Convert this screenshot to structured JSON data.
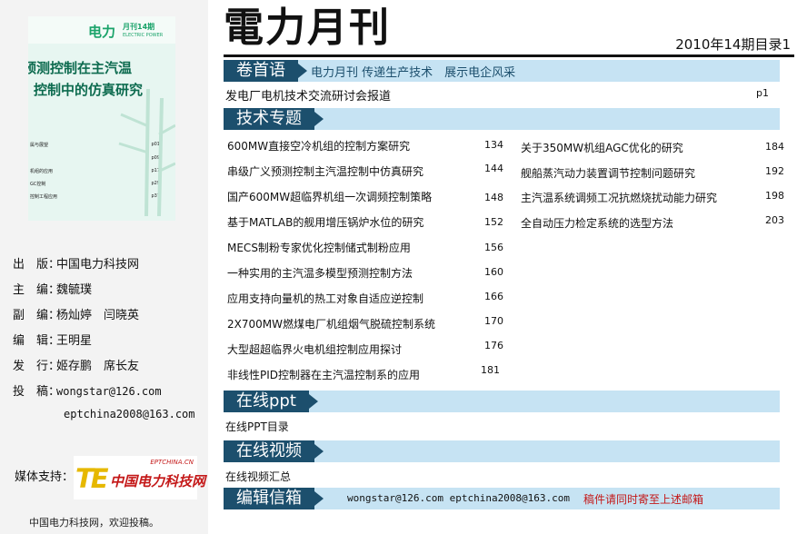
{
  "cover": {
    "brand": "电力",
    "issue": "月刊14期",
    "subtitle": "ELECTRIC POWER",
    "title_line1": "预测控制在主汽温",
    "title_line2": "控制中的仿真研究",
    "toc": [
      {
        "text": "属与展望",
        "page": "p01"
      },
      {
        "text": "",
        "page": "p09"
      },
      {
        "text": "机组的应用",
        "page": "p17"
      },
      {
        "text": "GC控制",
        "page": "p29"
      },
      {
        "text": "控制工程应用",
        "page": "p37"
      }
    ]
  },
  "sidebar_info": {
    "publisher_label": "出　版：",
    "publisher": "中国电力科技网",
    "chief_label": "主　编：",
    "chief": "魏毓璞",
    "deputy_label": "副　编：",
    "deputy": "杨灿婷　闫晓英",
    "editor_label": "编　辑：",
    "editor": "王明星",
    "distributor_label": "发　行：",
    "distributor": "姬存鹏　席长友",
    "submit_label": "投　稿：",
    "email1": "wongstar@126.com",
    "email2": "eptchina2008@163.com",
    "media_label": "媒体支持：",
    "media_logo_te": "TE",
    "media_logo_name": "中国电力科技网",
    "media_logo_tag": "EPTCHINA.CN",
    "footer": "中国电力科技网，欢迎投稿。"
  },
  "header": {
    "masthead": "電力月刊",
    "issue": "2010年14期目录1"
  },
  "sections": {
    "preface": {
      "title": "卷首语",
      "slogan": "电力月刊 传递生产技术　展示电企风采",
      "items": [
        {
          "title": "发电厂电机技术交流研讨会报道",
          "page": "p1"
        }
      ]
    },
    "tech": {
      "title": "技术专题",
      "left": [
        {
          "title": "600MW直接空冷机组的控制方案研究",
          "page": "134"
        },
        {
          "title": "串级广义预测控制主汽温控制中仿真研究",
          "page": "144"
        },
        {
          "title": "国产600MW超临界机组一次调频控制策略",
          "page": "148"
        },
        {
          "title": "基于MATLAB的舰用增压锅炉水位的研究",
          "page": "152"
        },
        {
          "title": "MECS制粉专家优化控制储式制粉应用",
          "page": "156"
        },
        {
          "title": "一种实用的主汽温多模型预测控制方法",
          "page": "160"
        },
        {
          "title": "应用支持向量机的热工对象自适应逆控制",
          "page": "166"
        },
        {
          "title": "2X700MW燃煤电厂机组烟气脱硫控制系统",
          "page": "170"
        },
        {
          "title": "大型超超临界火电机组控制应用探讨",
          "page": "176"
        },
        {
          "title": "非线性PID控制器在主汽温控制系的应用",
          "page": "181"
        }
      ],
      "right": [
        {
          "title": "关于350MW机组AGC优化的研究",
          "page": "184"
        },
        {
          "title": "舰船蒸汽动力装置调节控制问题研究",
          "page": "192"
        },
        {
          "title": "主汽温系统调频工况抗燃烧扰动能力研究",
          "page": "198"
        },
        {
          "title": "全自动压力检定系统的选型方法",
          "page": "203"
        }
      ]
    },
    "ppt": {
      "title": "在线ppt",
      "item": "在线PPT目录"
    },
    "video": {
      "title": "在线视频",
      "item": "在线视频汇总"
    },
    "contact": {
      "title": "编辑信箱",
      "emails": "wongstar@126.com  eptchina2008@163.com",
      "note": "稿件请同时寄至上述邮箱"
    }
  },
  "colors": {
    "band": "#c6e3f3",
    "tab": "#1c4f6d",
    "note": "#c41818",
    "logo": "#e6b800"
  }
}
